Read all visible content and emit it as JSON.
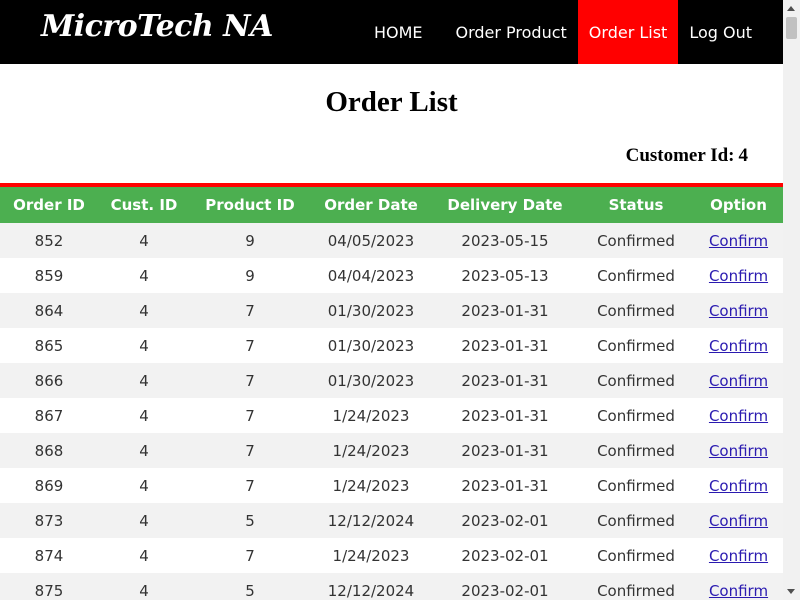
{
  "brand": "MicroTech NA",
  "nav": [
    "HOME",
    "Order Product",
    "Order List",
    "Log Out"
  ],
  "page_title": "Order List",
  "customer_label": "Customer Id:",
  "customer_id": "4",
  "table": {
    "headers": [
      "Order ID",
      "Cust. ID",
      "Product ID",
      "Order Date",
      "Delivery Date",
      "Status",
      "Option"
    ],
    "rows": [
      [
        "852",
        "4",
        "9",
        "04/05/2023",
        "2023-05-15",
        "Confirmed",
        "Confirm"
      ],
      [
        "859",
        "4",
        "9",
        "04/04/2023",
        "2023-05-13",
        "Confirmed",
        "Confirm"
      ],
      [
        "864",
        "4",
        "7",
        "01/30/2023",
        "2023-01-31",
        "Confirmed",
        "Confirm"
      ],
      [
        "865",
        "4",
        "7",
        "01/30/2023",
        "2023-01-31",
        "Confirmed",
        "Confirm"
      ],
      [
        "866",
        "4",
        "7",
        "01/30/2023",
        "2023-01-31",
        "Confirmed",
        "Confirm"
      ],
      [
        "867",
        "4",
        "7",
        "1/24/2023",
        "2023-01-31",
        "Confirmed",
        "Confirm"
      ],
      [
        "868",
        "4",
        "7",
        "1/24/2023",
        "2023-01-31",
        "Confirmed",
        "Confirm"
      ],
      [
        "869",
        "4",
        "7",
        "1/24/2023",
        "2023-01-31",
        "Confirmed",
        "Confirm"
      ],
      [
        "873",
        "4",
        "5",
        "12/12/2024",
        "2023-02-01",
        "Confirmed",
        "Confirm"
      ],
      [
        "874",
        "4",
        "7",
        "1/24/2023",
        "2023-02-01",
        "Confirmed",
        "Confirm"
      ],
      [
        "875",
        "4",
        "5",
        "12/12/2024",
        "2023-02-01",
        "Confirmed",
        "Confirm"
      ]
    ]
  },
  "colors": {
    "nav_bg": "#000000",
    "active_nav": "#ff0000",
    "header_bg": "#4caf50",
    "rule": "#ff0000",
    "odd_row": "#f2f2f2"
  }
}
